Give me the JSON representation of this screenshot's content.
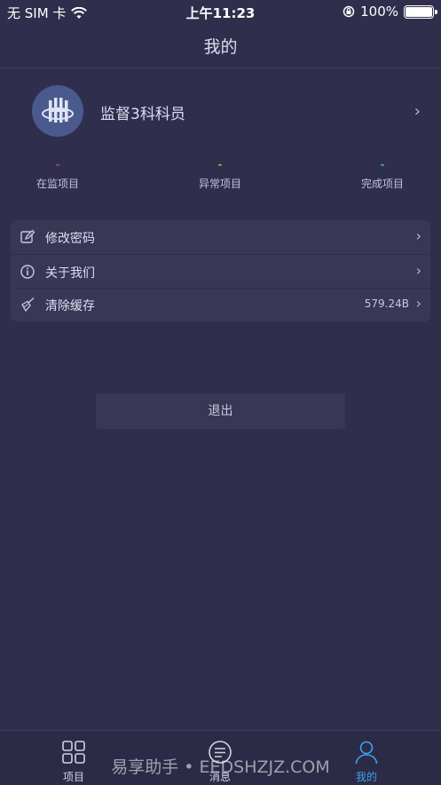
{
  "status_bar": {
    "carrier": "无 SIM 卡",
    "time": "上午11:23",
    "battery": "100%"
  },
  "header": {
    "title": "我的"
  },
  "profile": {
    "name": "监督3科科员"
  },
  "stats": [
    {
      "label": "在监项目",
      "value": "-",
      "color": "#e23a6a"
    },
    {
      "label": "异常项目",
      "value": "-",
      "color": "#f0a93a"
    },
    {
      "label": "完成项目",
      "value": "-",
      "color": "#3ecf92"
    }
  ],
  "menu": {
    "items": [
      {
        "label": "修改密码",
        "icon": "edit-icon"
      },
      {
        "label": "关于我们",
        "icon": "info-icon"
      },
      {
        "label": "清除缓存",
        "icon": "broom-icon",
        "value": "579.24B"
      }
    ]
  },
  "logout": {
    "label": "退出"
  },
  "tabbar": {
    "items": [
      {
        "label": "项目",
        "icon": "grid-icon",
        "active": false
      },
      {
        "label": "消息",
        "icon": "message-icon",
        "active": false
      },
      {
        "label": "我的",
        "icon": "user-icon",
        "active": true
      }
    ]
  },
  "watermark": "易享助手 • EEDSHZJZ.COM",
  "colors": {
    "background": "#2f2f4d",
    "card": "#383856",
    "accent": "#3ea0f0"
  }
}
